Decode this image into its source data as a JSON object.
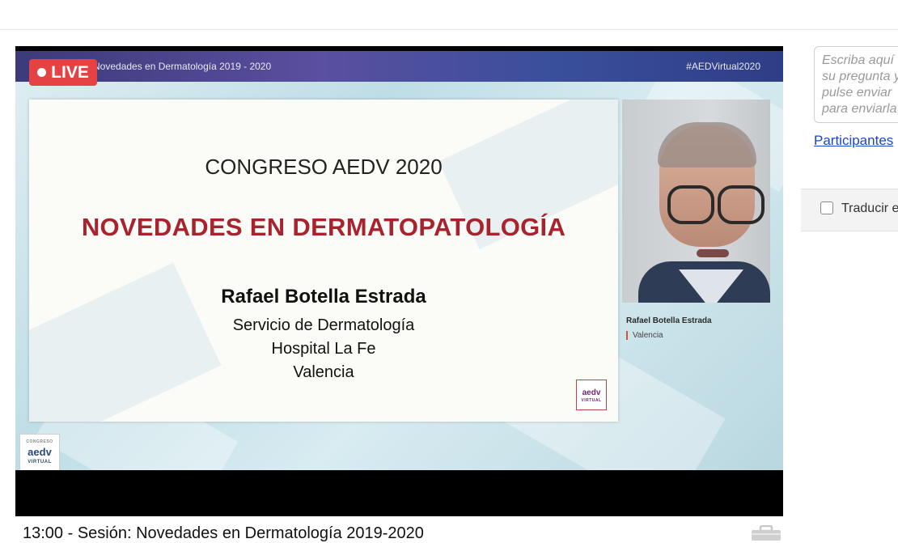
{
  "live_badge": {
    "label": "LIVE"
  },
  "stage": {
    "header_title": "Novedades en Dermatología 2019 - 2020",
    "header_tag": "#AEDVirtual2020"
  },
  "slide": {
    "congress": "CONGRESO AEDV 2020",
    "headline": "NOVEDADES EN DERMATOPATOLOGÍA",
    "speaker": "Rafael Botella Estrada",
    "line1": "Servicio de Dermatología",
    "line2": "Hospital La Fe",
    "line3": "Valencia",
    "logo_text": "aedv",
    "logo_sub": "VIRTUAL"
  },
  "camera": {
    "name": "Rafael Botella Estrada",
    "city": "Valencia"
  },
  "corner_logo": {
    "top": "CONGRESO",
    "main": "aedv",
    "sub": "VIRTUAL"
  },
  "chat": {
    "placeholder": "Escriba aquí su pregunta y pulse enviar para enviarla"
  },
  "participants_link": "Participantes",
  "translate": {
    "label": "Traducir el chat",
    "checked": false
  },
  "session_title": "13:00 - Sesión: Novedades en Dermatología 2019-2020",
  "colors": {
    "live_red": "#e54343",
    "headline_red": "#a8232d",
    "link_blue": "#1a46c9"
  }
}
